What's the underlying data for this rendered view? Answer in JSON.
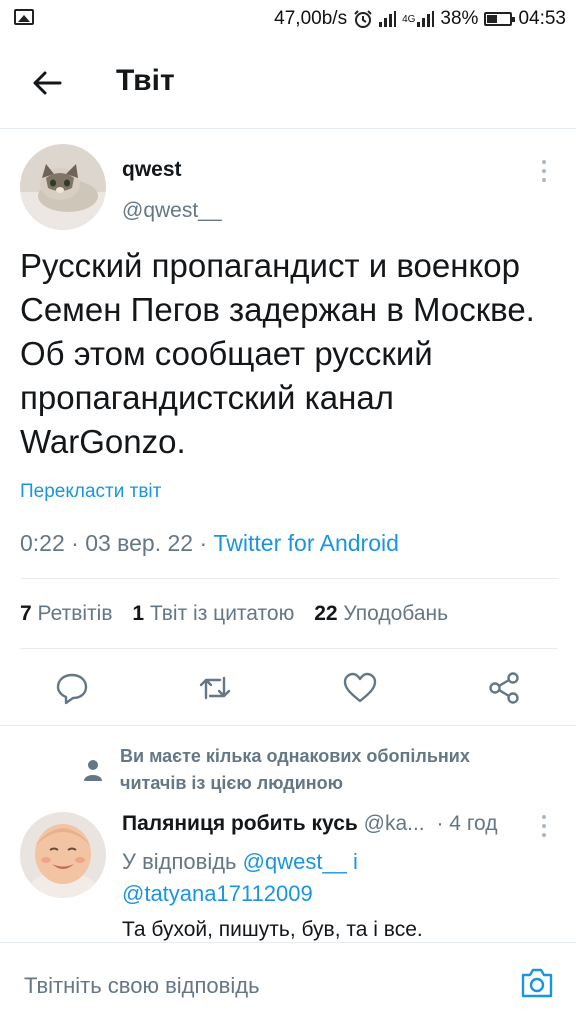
{
  "status_bar": {
    "speed": "47,00b/s",
    "network": "4G",
    "battery_pct": "38%",
    "battery_level": 0.38,
    "time": "04:53",
    "icons": [
      "image-icon",
      "alarm-icon",
      "signal-icon",
      "signal-4g-icon",
      "battery-icon"
    ]
  },
  "header": {
    "title": "Твіт",
    "back_icon": "arrow-left-icon"
  },
  "tweet": {
    "author_name": "qwest",
    "author_handle": "@qwest__",
    "text": "Русский пропагандист и военкор Семен Пегов задержан в Москве. Об этом сообщает русский пропагандистский канал WarGonzo.",
    "translate_link": "Перекласти твіт",
    "timestamp": "0:22 · 03 вер. 22 · ",
    "source": "Twitter for Android",
    "stats": {
      "retweets_count": "7",
      "retweets_label": "Ретвітів",
      "quotes_count": "1",
      "quotes_label": "Твіт із цитатою",
      "likes_count": "22",
      "likes_label": "Уподобань"
    },
    "actions": [
      "reply-icon",
      "retweet-icon",
      "like-icon",
      "share-icon"
    ]
  },
  "reply": {
    "social_context": "Ви маєте кілька однакових обопільних читачів із цією людиною",
    "author_name": "Паляниця робить кусь",
    "author_handle": "@ka...",
    "time": "· 4 год",
    "reply_prefix": "У відповідь ",
    "reply_user1": "@qwest__",
    "reply_and": " і",
    "reply_user2": "@tatyana17112009",
    "text": "Та бухой, пишуть, був, та і все."
  },
  "compose": {
    "placeholder": "Твітніть свою відповідь",
    "camera_icon": "camera-icon"
  },
  "colors": {
    "link": "#1b95e0",
    "muted": "#657786",
    "text": "#14171a",
    "divider": "#e6ecf0"
  }
}
